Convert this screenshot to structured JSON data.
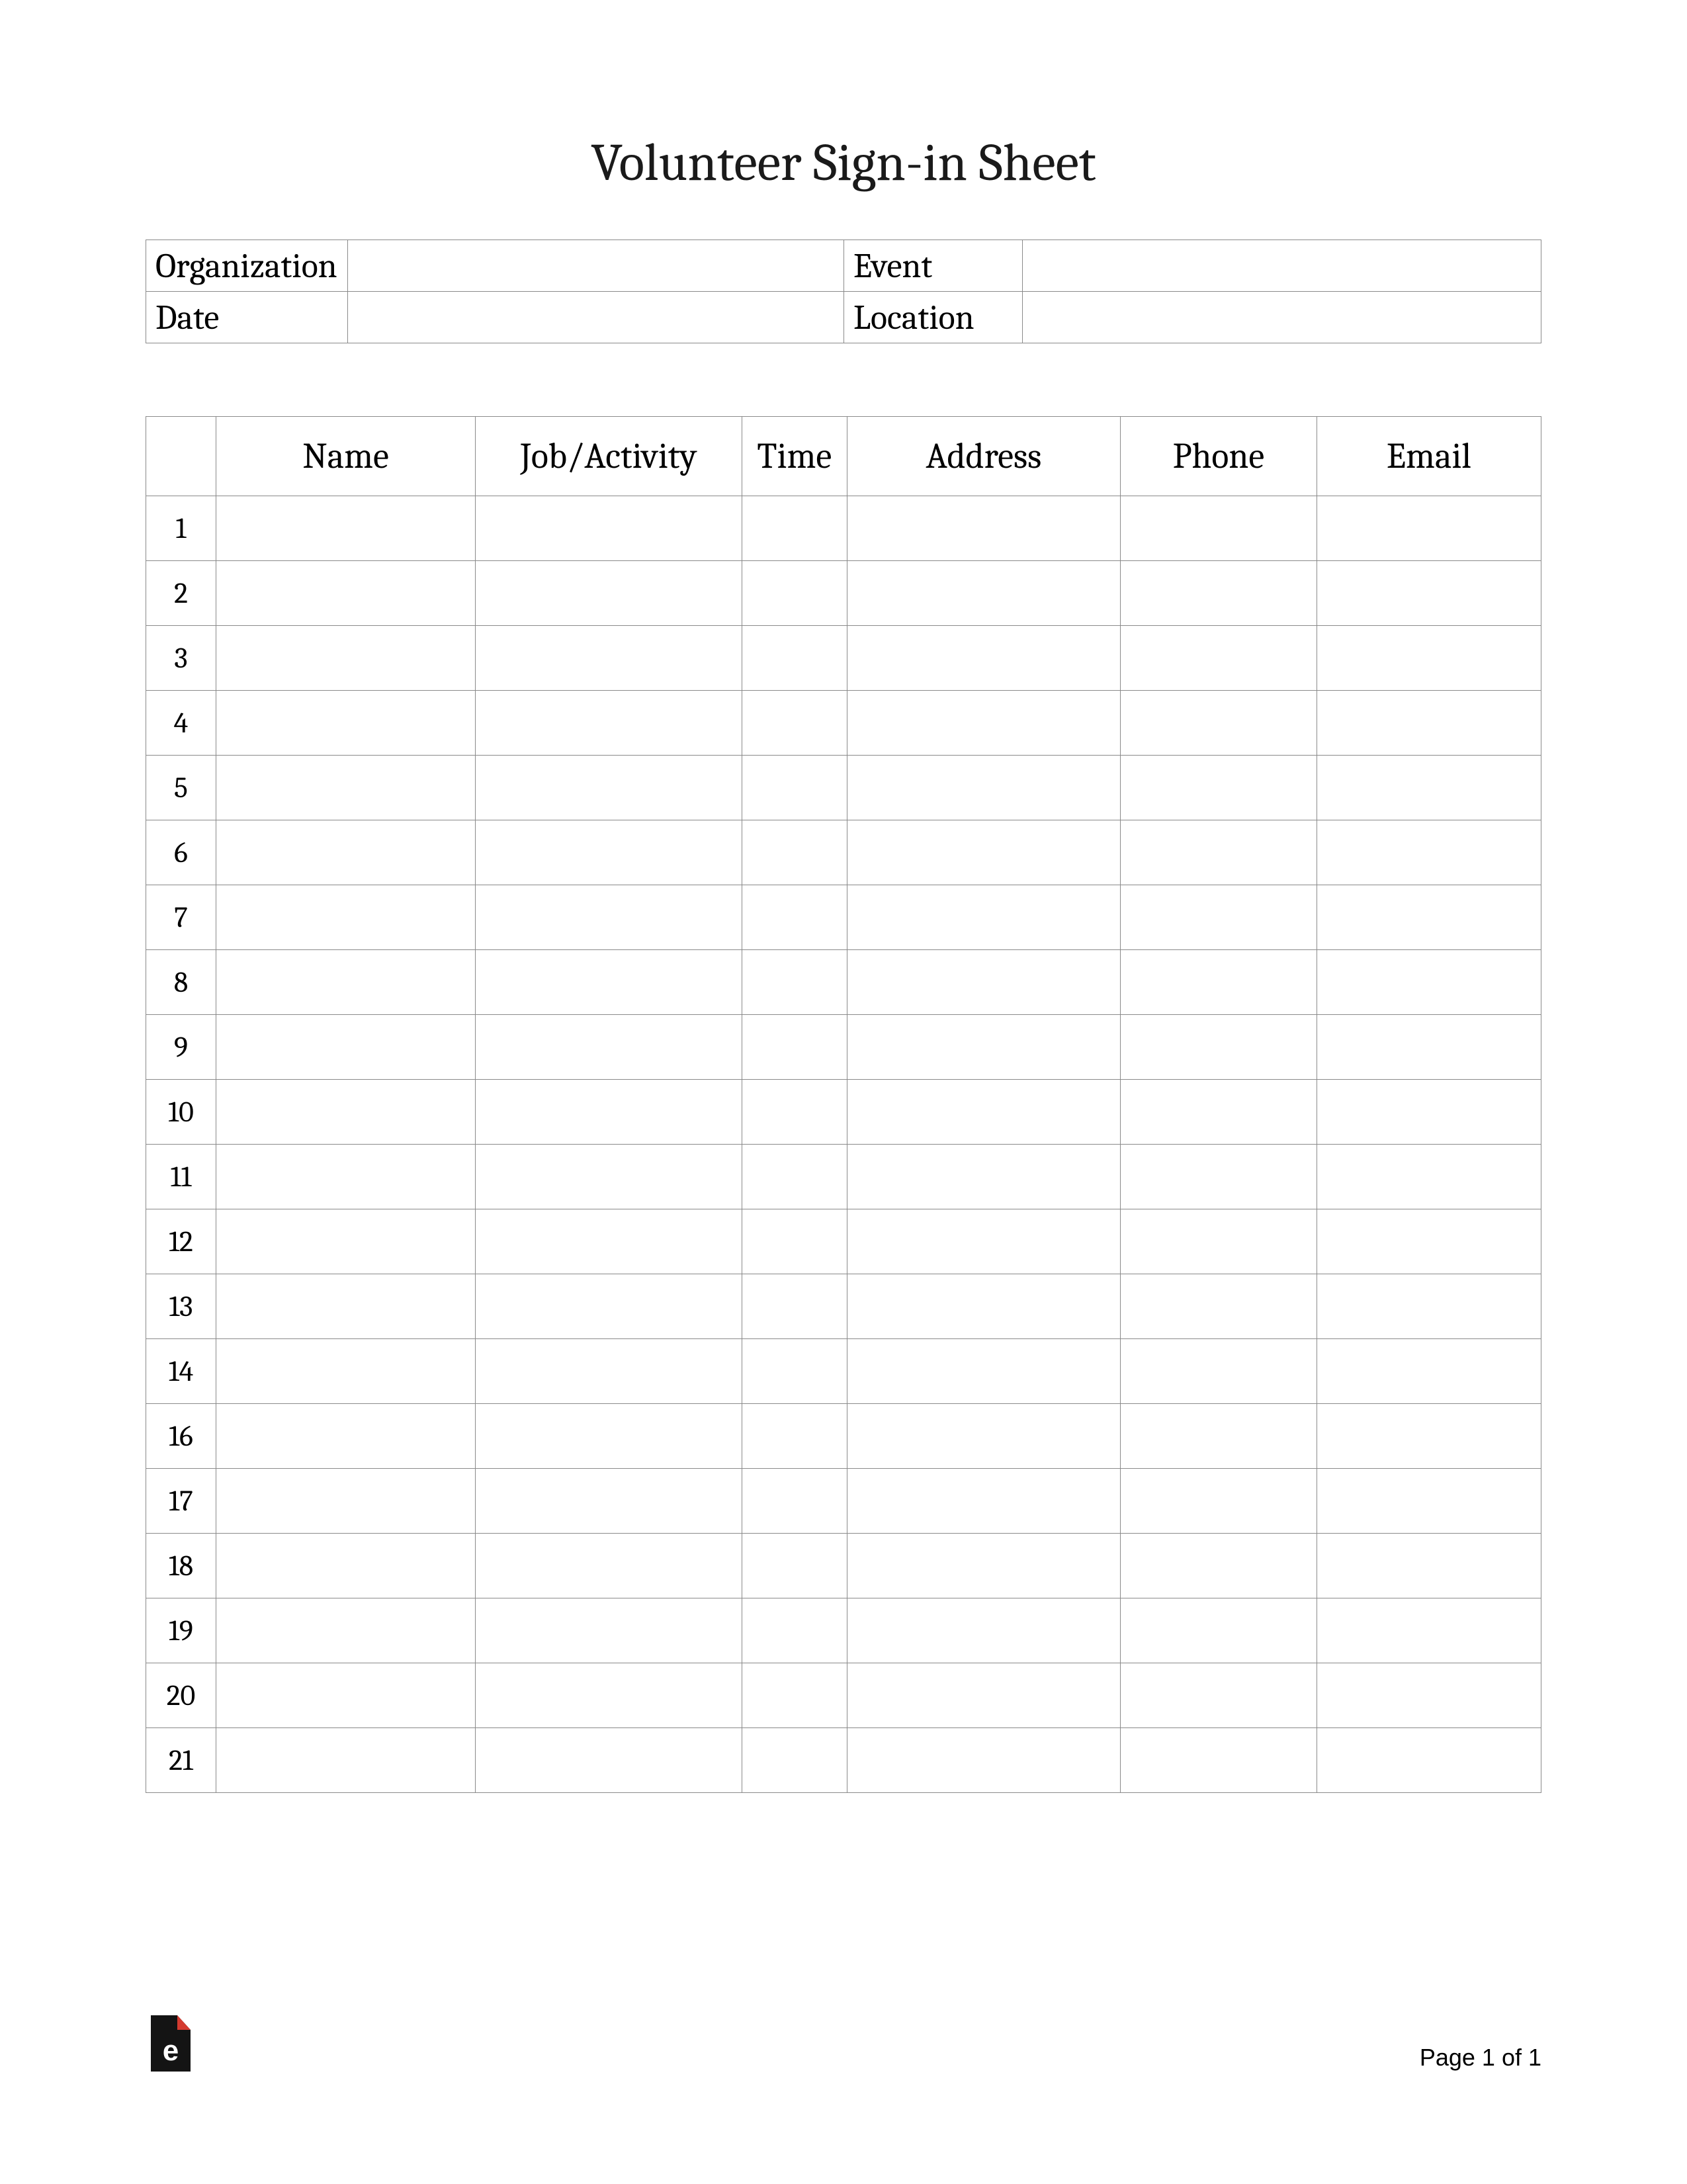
{
  "title": "Volunteer Sign-in Sheet",
  "meta": {
    "organization_label": "Organization",
    "organization_value": "",
    "event_label": "Event",
    "event_value": "",
    "date_label": "Date",
    "date_value": "",
    "location_label": "Location",
    "location_value": ""
  },
  "columns": {
    "num": "",
    "name": "Name",
    "job": "Job/Activity",
    "time": "Time",
    "address": "Address",
    "phone": "Phone",
    "email": "Email"
  },
  "rows": [
    "1",
    "2",
    "3",
    "4",
    "5",
    "6",
    "7",
    "8",
    "9",
    "10",
    "11",
    "12",
    "13",
    "14",
    "16",
    "17",
    "18",
    "19",
    "20",
    "21"
  ],
  "footer": {
    "page_text": "Page 1 of 1"
  }
}
